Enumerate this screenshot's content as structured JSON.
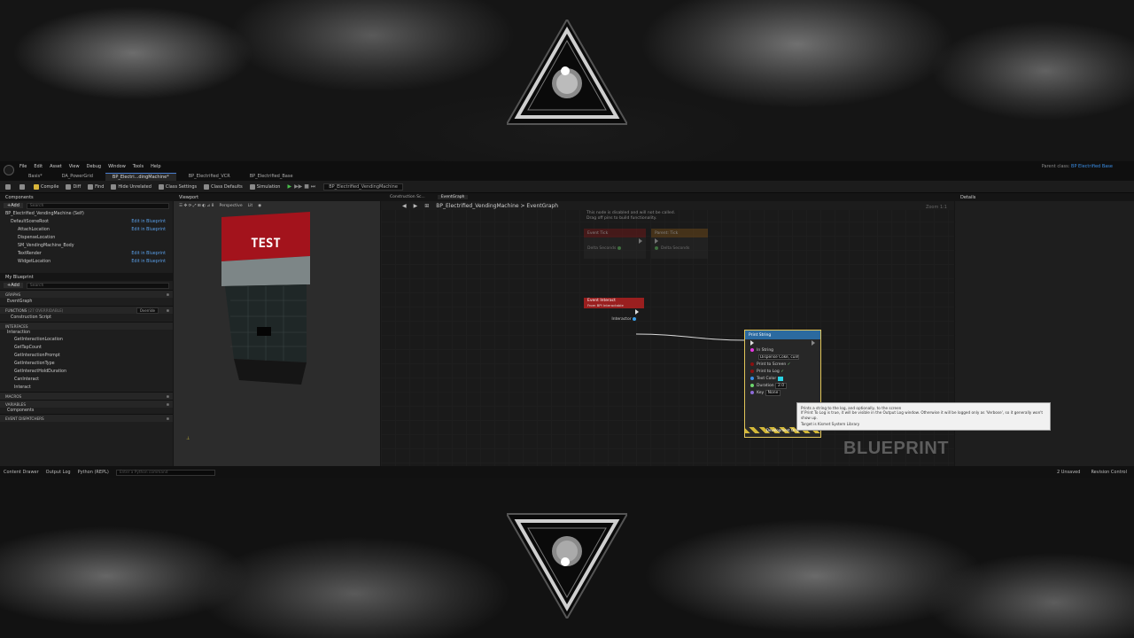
{
  "menu": [
    "File",
    "Edit",
    "Asset",
    "View",
    "Debug",
    "Window",
    "Tools",
    "Help"
  ],
  "parent_class": {
    "label": "Parent class:",
    "value": "BP Electrified Base"
  },
  "editor_tabs": [
    {
      "label": "Basis*"
    },
    {
      "label": "DA_PowerGrid"
    },
    {
      "label": "BP_Electri...dingMachine*"
    },
    {
      "label": "BP_Electrified_VCR"
    },
    {
      "label": "BP_Electrified_Base"
    }
  ],
  "toolbar": {
    "compile": "Compile",
    "diff": "Diff",
    "find": "Find",
    "hide_unrelated": "Hide Unrelated",
    "class_settings": "Class Settings",
    "class_defaults": "Class Defaults",
    "simulation": "Simulation",
    "debug_object": "BP_Electrified_VendingMachine"
  },
  "components": {
    "title": "Components",
    "add": "+Add",
    "search_placeholder": "Search",
    "items": [
      {
        "label": "BP_Electrified_VendingMachine (Self)",
        "edit": ""
      },
      {
        "label": "DefaultSceneRoot",
        "edit": "Edit in Blueprint"
      },
      {
        "label": "AttachLocation",
        "edit": "Edit in Blueprint"
      },
      {
        "label": "DispenseLocation",
        "edit": ""
      },
      {
        "label": "SM_VendingMachine_Body",
        "edit": ""
      },
      {
        "label": "TextRender",
        "edit": "Edit in Blueprint"
      },
      {
        "label": "WidgetLocation",
        "edit": "Edit in Blueprint"
      }
    ]
  },
  "my_blueprint": {
    "title": "My Blueprint",
    "add": "+Add",
    "search_placeholder": "Search",
    "graphs_label": "GRAPHS",
    "event_graph": "EventGraph",
    "functions_label": "FUNCTIONS",
    "functions_count": "(27 OVERRIDABLE)",
    "override": "Override",
    "construction_script": "Construction Script",
    "interfaces_label": "INTERFACES",
    "interaction_label": "Interaction",
    "interface_items": [
      "GetInteractionLocation",
      "GetTapCount",
      "GetInteractionPrompt",
      "GetInteractionType",
      "GetInteractHoldDuration",
      "CanInteract",
      "Interact"
    ],
    "macros_label": "MACROS",
    "variables_label": "VARIABLES",
    "components_label": "Components",
    "dispatchers_label": "EVENT DISPATCHERS"
  },
  "viewport": {
    "title": "Viewport",
    "perspective": "Perspective",
    "lit": "Lit",
    "machine_text": "TEST"
  },
  "graph": {
    "tabs": [
      "Construction Sc...",
      "EventGraph"
    ],
    "breadcrumb": "BP_Electrified_VendingMachine > EventGraph",
    "zoom": "Zoom 1:1",
    "watermark": "BLUEPRINT",
    "disabled_note_1": "This node is disabled and will not be called.",
    "disabled_note_2": "Drag off pins to build functionality.",
    "ghost_nodes": [
      {
        "title": "Event Tick",
        "pin": "Delta Seconds"
      },
      {
        "title": "Parent: Tick",
        "pin": "Delta Seconds"
      }
    ],
    "event_node": {
      "title": "Event Interact",
      "subtitle": "From BPI Interactable",
      "pin": "Interactor"
    },
    "print_node": {
      "title": "Print String",
      "in_string_label": "In String",
      "in_string_value": "Dispense Coke, cunt",
      "print_screen": "Print to Screen",
      "print_log": "Print to Log",
      "text_color": "Text Color",
      "duration_label": "Duration",
      "duration_value": "2.0",
      "key_label": "Key",
      "key_value": "None",
      "dev_only": "Development Only"
    }
  },
  "tooltip": {
    "line1": "Prints a string to the log, and optionally, to the screen",
    "line2": "If Print To Log is true, it will be visible in the Output Log window.  Otherwise it will be logged only as 'Verbose', so it generally won't show up.",
    "line3": "Target is Kismet System Library"
  },
  "details": {
    "title": "Details"
  },
  "status": {
    "content_drawer": "Content Drawer",
    "output_log": "Output Log",
    "python": "Python (REPL)",
    "cmd_placeholder": "Enter a Python command",
    "unsaved": "2 Unsaved",
    "revision": "Revision Control"
  },
  "colors": {
    "accent": "#3a8ee6",
    "event_red": "#9a1f1f",
    "function_blue": "#2b6aa0",
    "selection_gold": "#e2c65a"
  }
}
